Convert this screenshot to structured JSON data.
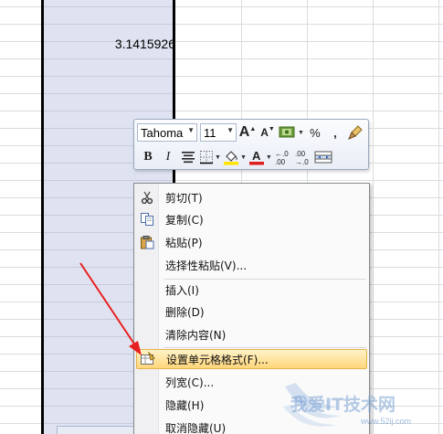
{
  "sheet": {
    "cell_value": "3.1415926"
  },
  "mini_toolbar": {
    "font_name": "Tahoma",
    "font_size": "11",
    "bold_label": "B",
    "italic_label": "I",
    "percent_label": "%",
    "comma_label": ",",
    "font_color": "#e02020",
    "highlight_color": "#ffe600"
  },
  "context_menu": {
    "items": [
      {
        "label": "剪切(T)",
        "icon": "scissors-icon"
      },
      {
        "label": "复制(C)",
        "icon": "copy-icon"
      },
      {
        "label": "粘贴(P)",
        "icon": "paste-icon"
      },
      {
        "label": "选择性粘贴(V)...",
        "icon": ""
      },
      {
        "label": "插入(I)",
        "icon": ""
      },
      {
        "label": "删除(D)",
        "icon": ""
      },
      {
        "label": "清除内容(N)",
        "icon": ""
      },
      {
        "label": "设置单元格格式(F)...",
        "icon": "format-cells-icon"
      },
      {
        "label": "列宽(C)...",
        "icon": ""
      },
      {
        "label": "隐藏(H)",
        "icon": ""
      },
      {
        "label": "取消隐藏(U)",
        "icon": ""
      }
    ],
    "highlighted_index": 7
  },
  "watermark": {
    "text": "我爱IT技术网",
    "url": "www.52ij.com"
  },
  "colors": {
    "selected_column": "#dfe3f1",
    "menu_highlight": "#ffd67a",
    "arrow": "#e81e1e"
  }
}
